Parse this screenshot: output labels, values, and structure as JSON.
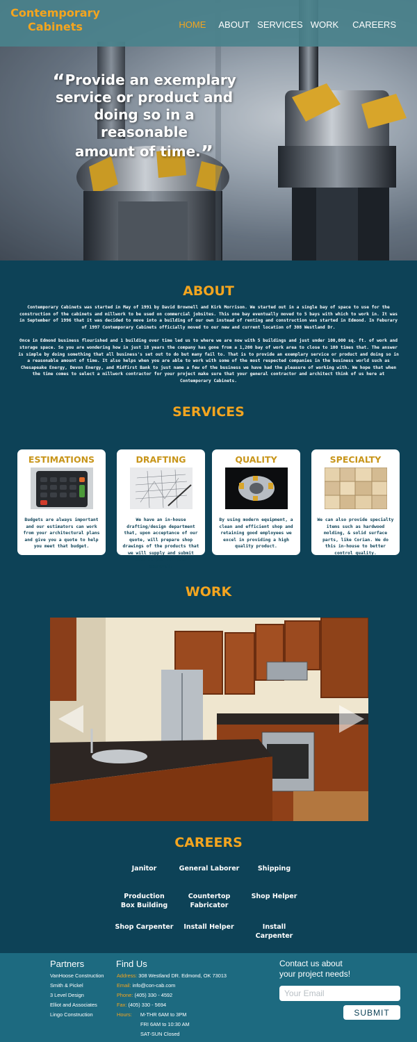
{
  "brand": {
    "line1": "Contemporary",
    "line2": "Cabinets"
  },
  "nav": {
    "home": "HOME",
    "about": "ABOUT",
    "services": "SERVICES",
    "work": "WORK",
    "careers": "CAREERS"
  },
  "hero": {
    "quote_line1": "Provide an exemplary",
    "quote_line2": "service or product and",
    "quote_line3": "doing so in a reasonable",
    "quote_line4": "amount of time."
  },
  "about": {
    "title": "ABOUT",
    "p1": "Contemporary Cabinets was started in May of 1991 by David Brownell and Kirk Morrison. We started out in a single bay of space to use for the construction of the cabinets and millwork to be used on commercial jobsites. This one bay eventually moved to 5 bays with which to work in. It was in September of 1996 that it was decided to move into a building of our own instead of renting and construction was started in Edmond. In Feburary of 1997 Contemporary Cabinets officially moved to our new and current location of 308 Westland Dr.",
    "p2": "Once in Edmond business flourished and 1 building over time led us to where we are now with 5 buildings and just under 100,000 sq. ft. of work and storage space. So you are wondering how in just 18 years the company has gone from a 1,200 bay of work area to close to 100 times that. The answer is simple by doing something that all business's set out to do but many fail to. That is to provide an exemplary service or product and doing so in a reasonable amount of time. It also helps when you are able to work with some of the most respected companies in the business world such as Chesapeake Energy, Devon Energy, and Midfirst Bank to just name a few of the business we have had the pleasure of working with. We hope that when the time comes to select a millwork contractor for your project make sure that your general contractor and architect think of us here at Contemporary Cabinets."
  },
  "services": {
    "title": "SERVICES",
    "cards": [
      {
        "title": "ESTIMATIONS",
        "text": "Budgets are always important and our estimators can work from your architectural plans and give you a quote to help you meet that budget."
      },
      {
        "title": "DRAFTING",
        "text": "We have an in-house drafting/design department that, upon acceptance of our quote, will prepare shop drawings of the products that we will supply and submit them to you for your approval."
      },
      {
        "title": "QUALITY",
        "text": "By using modern equipment, a clean and efficient shop and retaining good employees we excel in providing a high quality product."
      },
      {
        "title": "SPECIALTY",
        "text": "We can also provide specialty items such as hardwood molding, & solid surface parts, like Corian. We do this in-house to better control quality."
      }
    ]
  },
  "work": {
    "title": "WORK"
  },
  "careers": {
    "title": "CAREERS",
    "jobs": [
      "Janitor",
      "General Laborer",
      "Shipping",
      "Production Box Building",
      "Countertop Fabricator",
      "Shop Helper",
      "Shop Carpenter",
      "Install Helper",
      "Install Carpenter"
    ]
  },
  "footer": {
    "partners_title": "Partners",
    "partners": [
      "VanHoose Construction",
      "Smith & Pickel",
      "3 Level Design",
      "Elliot and Associates",
      "Lingo Construction"
    ],
    "findus_title": "Find Us",
    "address_label": "Address:",
    "address": "308 Westland DR. Edmond, OK 73013",
    "email_label": "Email:",
    "email": "info@con-cab.com",
    "phone_label": "Phone:",
    "phone": "(405) 330 - 4592",
    "fax_label": "Fax:",
    "fax": "(405) 330 - 5694",
    "hours_label": "Hours:",
    "hours": [
      "M-THR 6AM to 3PM",
      "FRI 6AM to 10:30 AM",
      "SAT-SUN Closed"
    ],
    "contact_line1": "Contact us about",
    "contact_line2": "your project needs!",
    "email_placeholder": "Your Email",
    "submit": "SUBMIT"
  },
  "colors": {
    "background": "#0d4257",
    "accent": "#f4a51f",
    "footer": "#1d6a80",
    "header": "#4a828c"
  }
}
